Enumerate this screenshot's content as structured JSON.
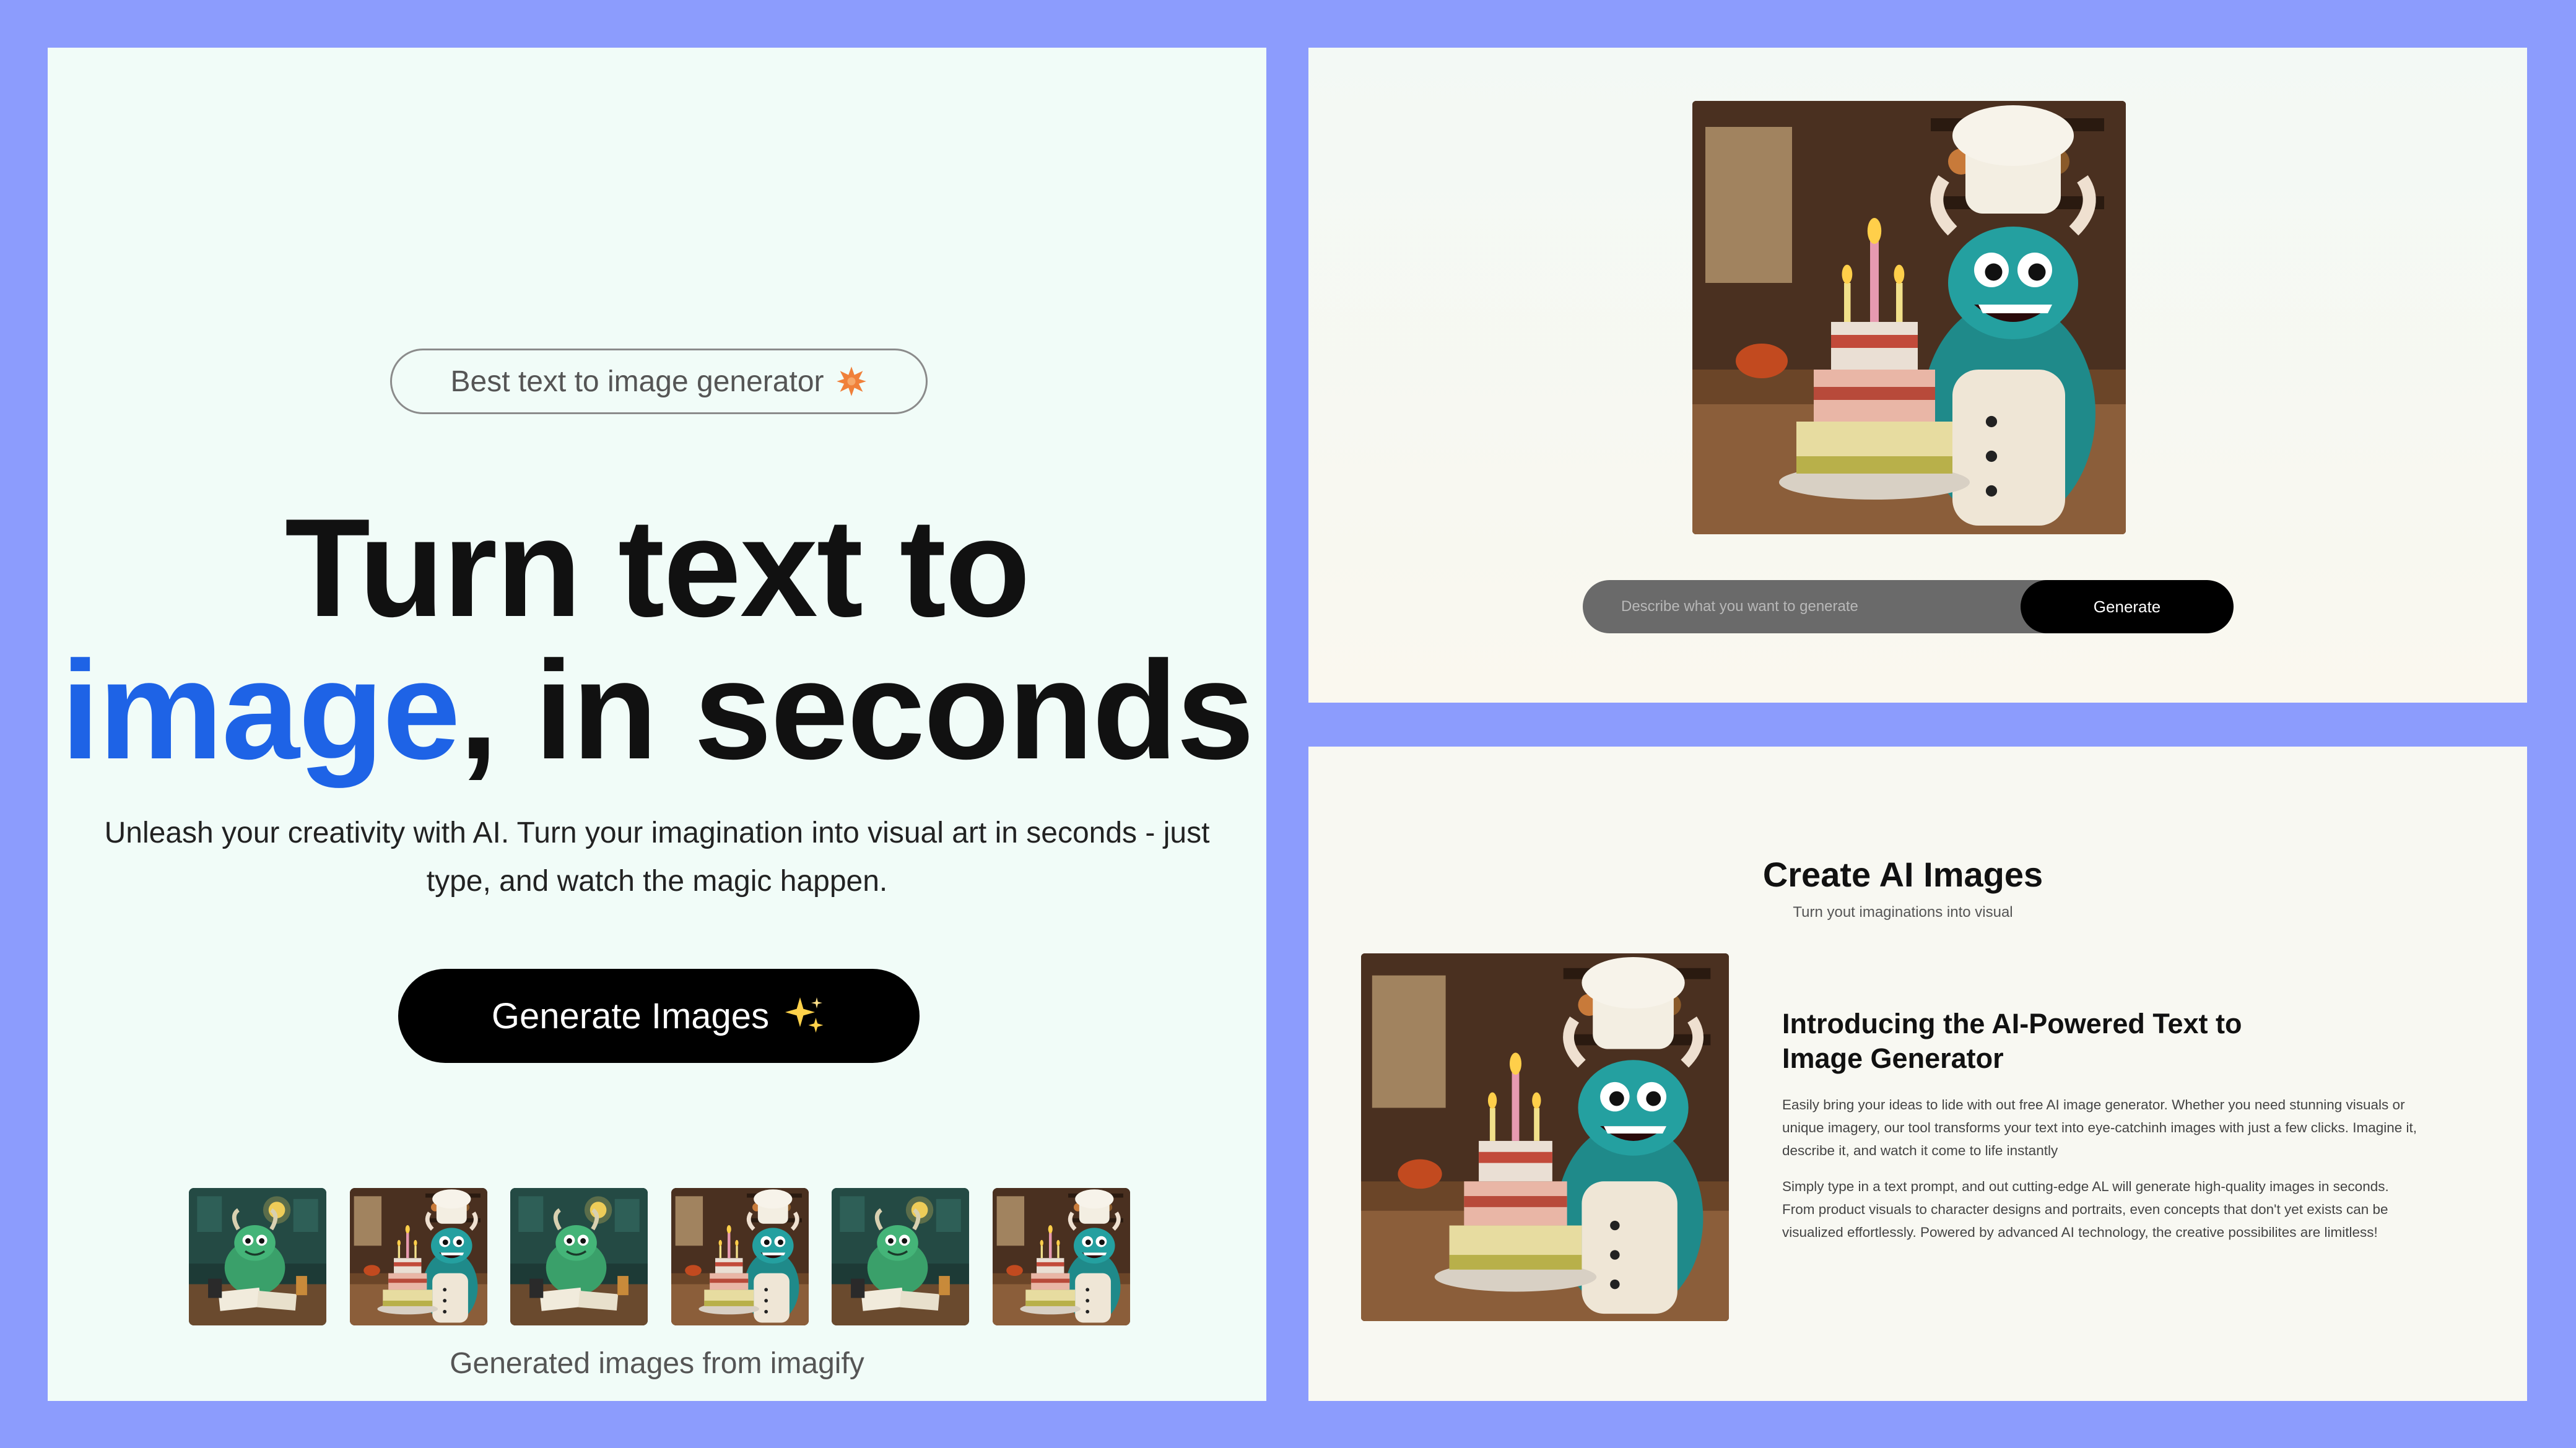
{
  "colors": {
    "frame_background": "#8c9cfd",
    "accent_blue": "#1e63e6",
    "button_black": "#000000",
    "prompt_bar_gray": "#6a6a6a"
  },
  "hero": {
    "badge": {
      "label": "Best text to image generator",
      "icon": "star-burst-icon"
    },
    "headline_line1": "Turn text to",
    "headline_accent": "image",
    "headline_rest": ", in seconds",
    "subtitle": "Unleash your creativity with AI. Turn your imagination into visual art in seconds - just type, and watch the magic happen.",
    "cta_label": "Generate Images",
    "cta_icon": "sparkles-icon",
    "thumbnails_caption": "Generated images from imagify"
  },
  "thumbnails": [
    {
      "subject": "green monster at desk"
    },
    {
      "subject": "chef monster with cake"
    },
    {
      "subject": "green monster at desk"
    },
    {
      "subject": "chef monster with cake"
    },
    {
      "subject": "green monster at desk"
    },
    {
      "subject": "chef monster with cake"
    }
  ],
  "generator": {
    "prompt_placeholder": "Describe what you want to generate",
    "prompt_value": "",
    "generate_label": "Generate"
  },
  "about": {
    "title": "Create AI Images",
    "subtitle": "Turn yout imaginations into visual",
    "heading": "Introducing the AI-Powered Text to Image Generator",
    "paragraph1": "Easily bring your ideas to lide with out free AI image generator. Whether you need stunning visuals or unique imagery, our tool transforms your text into eye-catchinh images with just a few clicks. Imagine it, describe it, and watch it come to life instantly",
    "paragraph2": "Simply type in a text prompt, and out cutting-edge AL will generate high-quality images in seconds. From product visuals to character designs and portraits, even concepts that don't yet exists can be visualized effortlessly. Powered by advanced AI technology, the creative possibilites are limitless!"
  }
}
